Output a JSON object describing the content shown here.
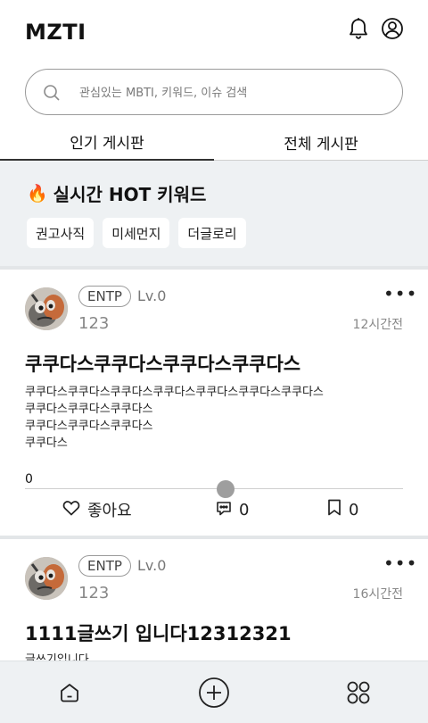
{
  "header": {
    "logo": "MZTI",
    "icons": [
      "bell-icon",
      "user-icon"
    ]
  },
  "search": {
    "placeholder": "관심있는 MBTI, 키워드, 이슈 검색",
    "value": ""
  },
  "tabs": [
    {
      "label": "인기 게시판",
      "active": true
    },
    {
      "label": "전체 게시판",
      "active": false
    }
  ],
  "hot": {
    "emoji": "🔥",
    "title": "실시간 HOT 키워드",
    "keywords": [
      "권고사직",
      "미세먼지",
      "더글로리"
    ]
  },
  "posts": [
    {
      "mbti": "ENTP",
      "level": "Lv.0",
      "username": "123",
      "time": "12시간전",
      "title": "쿠쿠다스쿠쿠다스쿠쿠다스쿠쿠다스",
      "body": "쿠쿠다스쿠쿠다스쿠쿠다스쿠쿠다스쿠쿠다스쿠쿠다스쿠쿠다스\n쿠쿠다스쿠쿠다스쿠쿠다스\n쿠쿠다스쿠쿠다스쿠쿠다스\n쿠쿠다스",
      "counter": "0",
      "like_label": "좋아요",
      "comments": "0",
      "bookmarks": "0"
    },
    {
      "mbti": "ENTP",
      "level": "Lv.0",
      "username": "123",
      "time": "16시간전",
      "title": "1111글쓰기 입니다12312321",
      "body": "글쓰기입니다"
    }
  ],
  "bottom_nav": [
    "home-icon",
    "add-circle-icon",
    "grid-icon"
  ]
}
